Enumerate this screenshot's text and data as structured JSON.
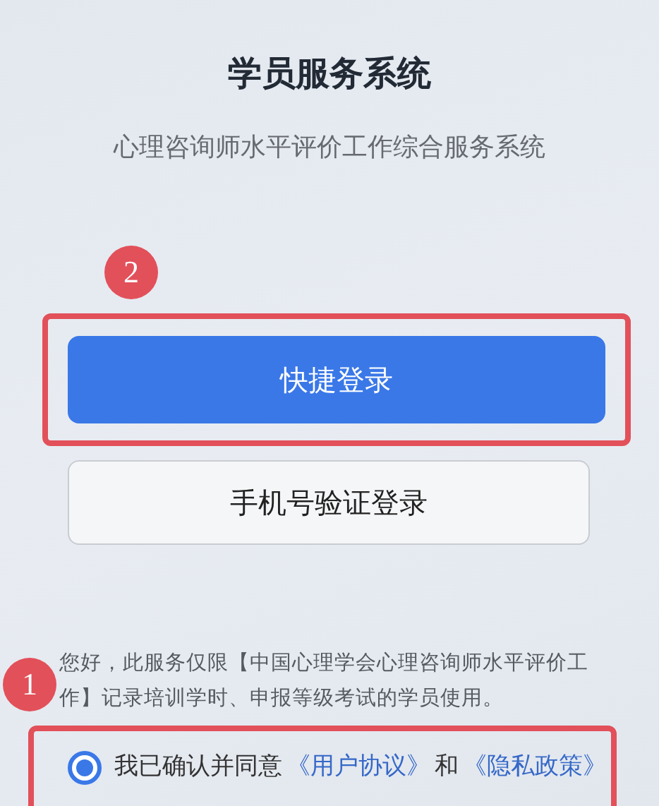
{
  "title": "学员服务系统",
  "subtitle": "心理咨询师水平评价工作综合服务系统",
  "step_markers": [
    {
      "label": "2"
    },
    {
      "label": "1"
    }
  ],
  "buttons": [
    {
      "label": "快捷登录",
      "kind": "primary",
      "highlighted": true
    },
    {
      "label": "手机号验证登录",
      "kind": "secondary",
      "highlighted": false
    }
  ],
  "notice": "您好，此服务仅限【中国心理学会心理咨询师水平评价工作】记录培训学时、申报等级考试的学员使用。",
  "agreement": {
    "checked": true,
    "highlighted": true,
    "parts": [
      {
        "text": "我已确认并同意",
        "kind": "text"
      },
      {
        "text": "《用户协议》",
        "kind": "link"
      },
      {
        "text": "和",
        "kind": "text"
      },
      {
        "text": "《隐私政策》",
        "kind": "link"
      }
    ]
  }
}
